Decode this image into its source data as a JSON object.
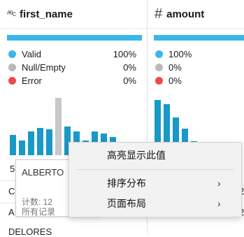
{
  "columns": [
    {
      "name": "first_name",
      "type_icon": "text-type-icon",
      "type_glyph": "ᴬᴮc",
      "stats": [
        {
          "label": "Valid",
          "value": "100%",
          "color": "#3ab7ec"
        },
        {
          "label": "Null/Empty",
          "value": "0%",
          "color": "#b9b9b9"
        },
        {
          "label": "Error",
          "value": "0%",
          "color": "#ec4b4b"
        }
      ],
      "valid_fraction": 1.0
    },
    {
      "name": "amount",
      "type_icon": "number-type-icon",
      "type_glyph": "#",
      "stats": [
        {
          "label": "",
          "value": "100%",
          "color": "#3ab7ec"
        },
        {
          "label": "",
          "value": "0%",
          "color": "#b9b9b9"
        },
        {
          "label": "",
          "value": "0%",
          "color": "#ec4b4b"
        }
      ],
      "valid_fraction": 1.0
    }
  ],
  "first_name_histogram": [
    0.35,
    0.25,
    0.42,
    0.48,
    0.45,
    1.0,
    0.5,
    0.42,
    0.25,
    0.42,
    0.38,
    0.32
  ],
  "first_name_histogram_null_index": 5,
  "amount_histogram": [
    1.0,
    0.92,
    0.68,
    0.48,
    0.25,
    0.15,
    0.1,
    0.08
  ],
  "fragments": {
    "left_5": "5",
    "left_c": "C",
    "left_a": "A",
    "left_bottom": "DELORES",
    "right_2a": "2",
    "right_2b": "2"
  },
  "tooltip": {
    "value": "ALBERTO",
    "count": "计数: 12",
    "all_records": "所有记录"
  },
  "context_menu": {
    "items": [
      {
        "label": "高亮显示此值",
        "has_submenu": false
      },
      {
        "label": "排序分布",
        "has_submenu": true
      },
      {
        "label": "页面布局",
        "has_submenu": true
      }
    ],
    "submenu_arrow": "›"
  }
}
